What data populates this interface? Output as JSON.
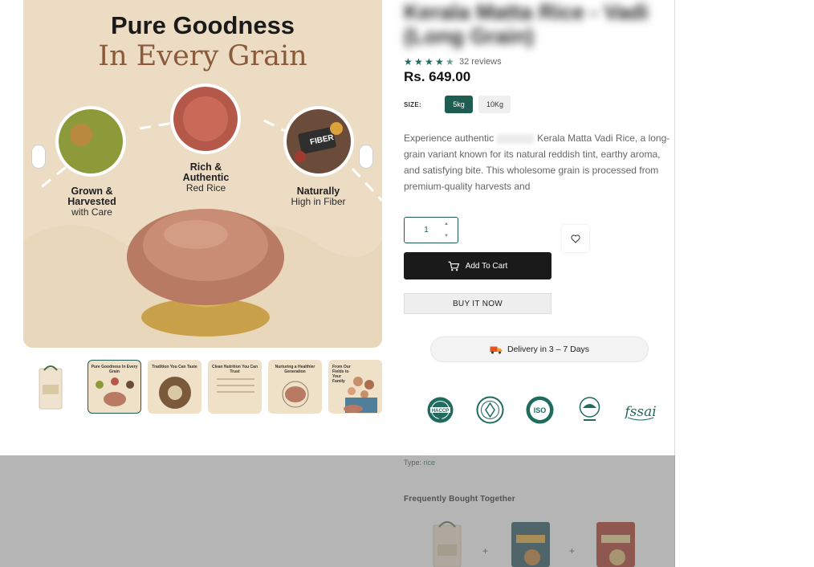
{
  "main_image": {
    "title_line1": "Pure Goodness",
    "title_line2": "In Every Grain",
    "features": [
      {
        "title": "Grown &",
        "title2": "Harvested",
        "sub": "with Care"
      },
      {
        "title": "Rich &",
        "title2": "Authentic",
        "sub": "Red Rice"
      },
      {
        "title": "Naturally",
        "title2": "",
        "sub": "High in Fiber"
      }
    ],
    "fiber_tag": "FIBER"
  },
  "thumbnails": [
    {
      "label": ""
    },
    {
      "label": "Pure Goodness In Every Grain"
    },
    {
      "label": "Tradition You Can Taste"
    },
    {
      "label": "Clean Nutrition You Can Trust"
    },
    {
      "label": "Nurturing a Healthier Generation"
    },
    {
      "label": "From Our Fields to Your Family"
    }
  ],
  "product": {
    "rating": 4.5,
    "reviews": "32 reviews",
    "price": "Rs. 649.00",
    "size_label": "SIZE:",
    "sizes": [
      "5kg",
      "10Kg"
    ],
    "selected_size": "5kg",
    "description_start": "Experience authentic",
    "description_rest": "Kerala Matta Vadi Rice, a long-grain variant known for its natural reddish tint, earthy aroma, and satisfying bite. This wholesome grain is processed from premium-quality harvests and",
    "quantity": "1",
    "add_to_cart": "Add To Cart",
    "buy_now": "BUY IT NOW",
    "delivery": "Delivery in 3 – 7 Days",
    "type_label": "Type:",
    "type_value": "rice",
    "fbt_heading": "Frequently Bought Together"
  },
  "badges": [
    "HACCP",
    "ISO",
    "fssai"
  ],
  "colors": {
    "accent": "#1f5c52",
    "dark_button": "#1a1a1a",
    "star": "#1f6b5e"
  }
}
